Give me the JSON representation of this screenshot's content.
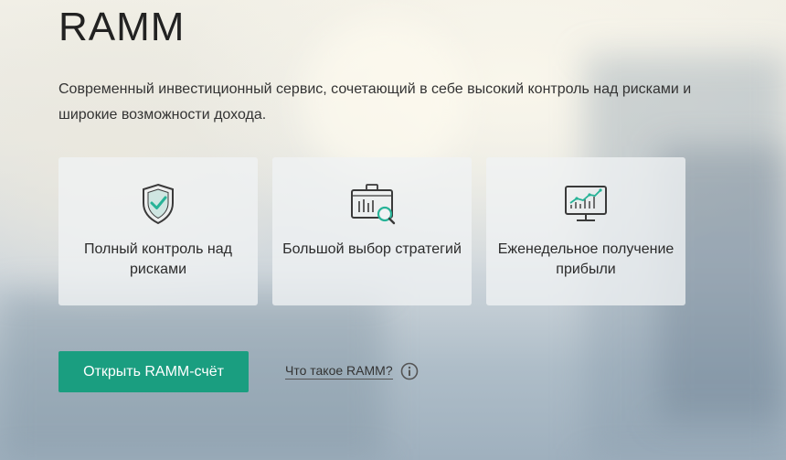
{
  "header": {
    "title": "RAMM",
    "description": "Современный инвестиционный сервис, сочетающий в себе высокий контроль над рисками и широкие возможности дохода."
  },
  "features": [
    {
      "icon": "shield-check-icon",
      "label": "Полный контроль над рисками"
    },
    {
      "icon": "briefcase-search-icon",
      "label": "Большой выбор стратегий"
    },
    {
      "icon": "monitor-chart-icon",
      "label": "Еженедельное получение прибыли"
    }
  ],
  "actions": {
    "open_account_label": "Открыть RAMM-счёт",
    "what_is_label": "Что такое RAMM?"
  },
  "colors": {
    "accent": "#1a9e80",
    "icon_stroke": "#3a3a3a",
    "icon_accent": "#26b397"
  }
}
